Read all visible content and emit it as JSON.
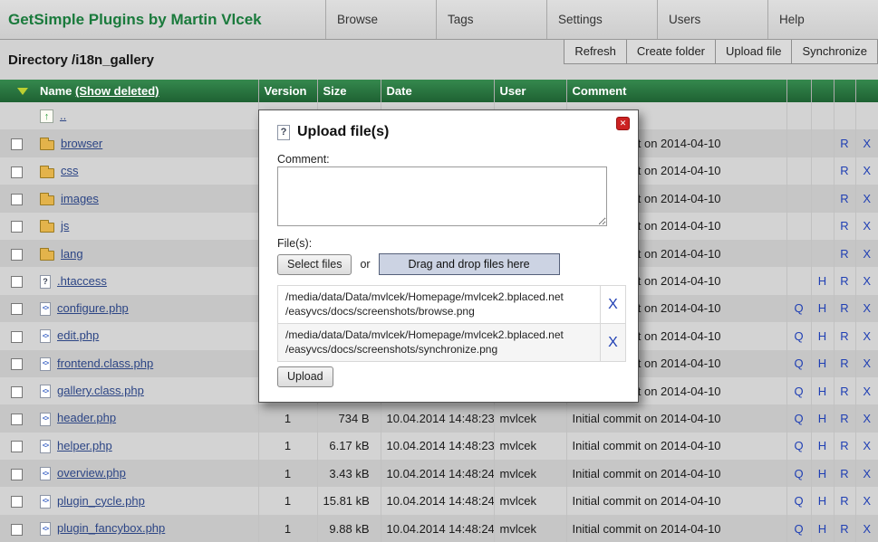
{
  "header": {
    "title": "GetSimple Plugins by Martin Vlcek",
    "nav": [
      {
        "label": "Browse"
      },
      {
        "label": "Tags"
      },
      {
        "label": "Settings"
      },
      {
        "label": "Users"
      },
      {
        "label": "Help"
      }
    ]
  },
  "toolbar": {
    "directory_label": "Directory /i18n_gallery",
    "buttons": [
      {
        "label": "Refresh"
      },
      {
        "label": "Create folder"
      },
      {
        "label": "Upload file"
      },
      {
        "label": "Synchronize"
      }
    ]
  },
  "table": {
    "headers": {
      "name": "Name",
      "show_deleted": "(Show deleted)",
      "version": "Version",
      "size": "Size",
      "date": "Date",
      "user": "User",
      "comment": "Comment"
    },
    "rows": [
      {
        "icon": "up",
        "checkbox": false,
        "name": "..",
        "version": "",
        "size": "",
        "date": "",
        "user": "",
        "comment": "",
        "actions": [
          "",
          "",
          "",
          ""
        ]
      },
      {
        "icon": "folder",
        "checkbox": true,
        "name": "browser",
        "version": "",
        "size": "",
        "date": "",
        "user": "",
        "comment": "Initial commit on 2014-04-10",
        "actions": [
          "",
          "",
          "R",
          "X"
        ]
      },
      {
        "icon": "folder",
        "checkbox": true,
        "name": "css",
        "version": "",
        "size": "",
        "date": "",
        "user": "",
        "comment": "Initial commit on 2014-04-10",
        "actions": [
          "",
          "",
          "R",
          "X"
        ]
      },
      {
        "icon": "folder",
        "checkbox": true,
        "name": "images",
        "version": "",
        "size": "",
        "date": "",
        "user": "",
        "comment": "Initial commit on 2014-04-10",
        "actions": [
          "",
          "",
          "R",
          "X"
        ]
      },
      {
        "icon": "folder",
        "checkbox": true,
        "name": "js",
        "version": "",
        "size": "",
        "date": "",
        "user": "",
        "comment": "Initial commit on 2014-04-10",
        "actions": [
          "",
          "",
          "R",
          "X"
        ]
      },
      {
        "icon": "folder",
        "checkbox": true,
        "name": "lang",
        "version": "",
        "size": "",
        "date": "",
        "user": "",
        "comment": "Initial commit on 2014-04-10",
        "actions": [
          "",
          "",
          "R",
          "X"
        ]
      },
      {
        "icon": "file-question",
        "checkbox": true,
        "name": ".htaccess",
        "version": "",
        "size": "",
        "date": "",
        "user": "",
        "comment": "Initial commit on 2014-04-10",
        "actions": [
          "",
          "H",
          "R",
          "X"
        ]
      },
      {
        "icon": "file-php",
        "checkbox": true,
        "name": "configure.php",
        "version": "",
        "size": "",
        "date": "",
        "user": "",
        "comment": "Initial commit on 2014-04-10",
        "actions": [
          "Q",
          "H",
          "R",
          "X"
        ]
      },
      {
        "icon": "file-php",
        "checkbox": true,
        "name": "edit.php",
        "version": "",
        "size": "",
        "date": "",
        "user": "",
        "comment": "Initial commit on 2014-04-10",
        "actions": [
          "Q",
          "H",
          "R",
          "X"
        ]
      },
      {
        "icon": "file-php",
        "checkbox": true,
        "name": "frontend.class.php",
        "version": "",
        "size": "",
        "date": "",
        "user": "",
        "comment": "Initial commit on 2014-04-10",
        "actions": [
          "Q",
          "H",
          "R",
          "X"
        ]
      },
      {
        "icon": "file-php",
        "checkbox": true,
        "name": "gallery.class.php",
        "version": "",
        "size": "",
        "date": "",
        "user": "",
        "comment": "Initial commit on 2014-04-10",
        "actions": [
          "Q",
          "H",
          "R",
          "X"
        ]
      },
      {
        "icon": "file-php",
        "checkbox": true,
        "name": "header.php",
        "version": "1",
        "size": "734 B",
        "date": "10.04.2014 14:48:23",
        "user": "mvlcek",
        "comment": "Initial commit on 2014-04-10",
        "actions": [
          "Q",
          "H",
          "R",
          "X"
        ]
      },
      {
        "icon": "file-php",
        "checkbox": true,
        "name": "helper.php",
        "version": "1",
        "size": "6.17 kB",
        "date": "10.04.2014 14:48:23",
        "user": "mvlcek",
        "comment": "Initial commit on 2014-04-10",
        "actions": [
          "Q",
          "H",
          "R",
          "X"
        ]
      },
      {
        "icon": "file-php",
        "checkbox": true,
        "name": "overview.php",
        "version": "1",
        "size": "3.43 kB",
        "date": "10.04.2014 14:48:24",
        "user": "mvlcek",
        "comment": "Initial commit on 2014-04-10",
        "actions": [
          "Q",
          "H",
          "R",
          "X"
        ]
      },
      {
        "icon": "file-php",
        "checkbox": true,
        "name": "plugin_cycle.php",
        "version": "1",
        "size": "15.81 kB",
        "date": "10.04.2014 14:48:24",
        "user": "mvlcek",
        "comment": "Initial commit on 2014-04-10",
        "actions": [
          "Q",
          "H",
          "R",
          "X"
        ]
      },
      {
        "icon": "file-php",
        "checkbox": true,
        "name": "plugin_fancybox.php",
        "version": "1",
        "size": "9.88 kB",
        "date": "10.04.2014 14:48:24",
        "user": "mvlcek",
        "comment": "Initial commit on 2014-04-10",
        "actions": [
          "Q",
          "H",
          "R",
          "X"
        ]
      }
    ]
  },
  "modal": {
    "title": "Upload file(s)",
    "close_label": "✕",
    "comment_label": "Comment:",
    "comment_value": "",
    "files_label": "File(s):",
    "select_files_button": "Select files",
    "or_text": "or",
    "dragdrop_label": "Drag and drop files here",
    "upload_button": "Upload",
    "files": [
      {
        "path": "/media/data/Data/mvlcek/Homepage/mvlcek2.bplaced.net\n/easyvcs/docs/screenshots/browse.png",
        "remove_label": "X"
      },
      {
        "path": "/media/data/Data/mvlcek/Homepage/mvlcek2.bplaced.net\n/easyvcs/docs/screenshots/synchronize.png",
        "remove_label": "X"
      }
    ]
  },
  "colors": {
    "brand_green": "#1a7a3c",
    "header_green_top": "#35894e",
    "header_green_bottom": "#1e6132",
    "row_light": "#d3d3d3",
    "row_dark": "#c6c6c6",
    "link_blue": "#2c4585",
    "action_blue": "#1f3fb4",
    "close_red": "#cc2222",
    "folder_yellow": "#e3b34b",
    "dragdrop_bg": "#ccd3e3"
  }
}
